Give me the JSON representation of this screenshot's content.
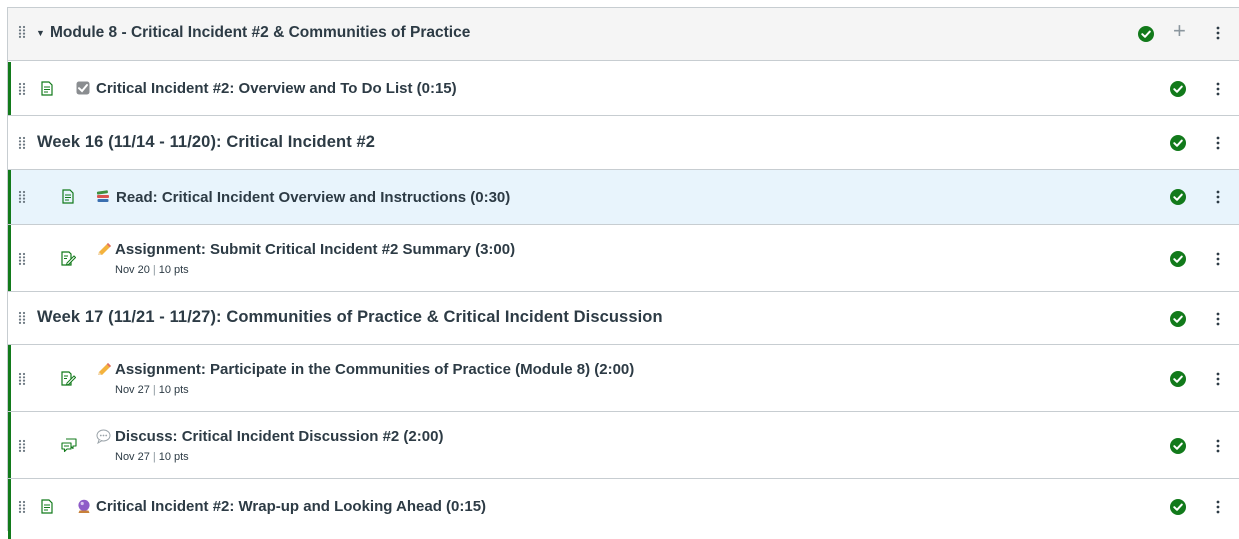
{
  "module": {
    "title": "Module 8 - Critical Incident #2 & Communities of Practice",
    "collapse_icon": "caret-down-icon",
    "add_icon": "plus-icon",
    "plus_glyph": "+"
  },
  "items": [
    {
      "type": "page",
      "emoji_icon": "checkbox-emoji",
      "label": "Critical Incident #2: Overview and To Do List (0:15)"
    },
    {
      "type": "subheader",
      "label": "Week 16 (11/14 - 11/20): Critical Incident #2"
    },
    {
      "type": "page",
      "emoji_icon": "books-emoji",
      "label": "Read: Critical Incident Overview and Instructions (0:30)"
    },
    {
      "type": "assignment",
      "emoji_icon": "pencil-emoji",
      "label": "Assignment: Submit Critical Incident #2 Summary (3:00)",
      "due": "Nov 20",
      "points": "10 pts",
      "separator": "|"
    },
    {
      "type": "subheader",
      "label": "Week 17 (11/21 - 11/27): Communities of Practice & Critical Incident Discussion"
    },
    {
      "type": "assignment",
      "emoji_icon": "pencil-emoji",
      "label": "Assignment: Participate in the Communities of Practice (Module 8) (2:00)",
      "due": "Nov 27",
      "points": "10 pts",
      "separator": "|"
    },
    {
      "type": "discussion",
      "emoji_icon": "speech-bubble-emoji",
      "label": "Discuss: Critical Incident Discussion #2 (2:00)",
      "due": "Nov 27",
      "points": "10 pts",
      "separator": "|"
    },
    {
      "type": "page",
      "emoji_icon": "crystal-ball-emoji",
      "label": "Critical Incident #2: Wrap-up and Looking Ahead (0:15)"
    }
  ],
  "colors": {
    "published": "#127a1b",
    "item_border_accent": "#127a1b",
    "highlight_row": "#e8f4fc",
    "header_bg": "#f5f5f5",
    "text": "#2d3b45"
  }
}
